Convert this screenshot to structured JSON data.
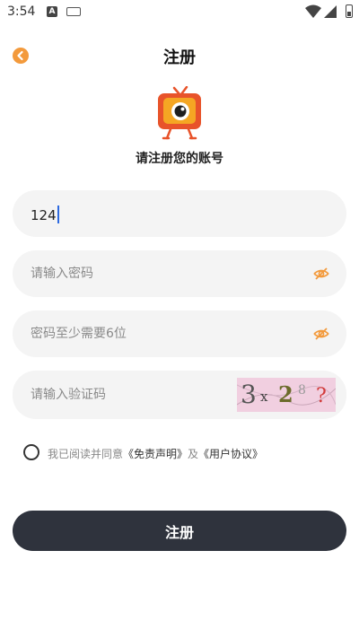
{
  "status_bar": {
    "time": "3:54",
    "notification_icon": "A",
    "icons": [
      "notification-a-icon",
      "keyboard-icon",
      "wifi-icon",
      "signal-icon",
      "battery-icon"
    ]
  },
  "header": {
    "title": "注册",
    "back_icon": "chevron-left-icon"
  },
  "logo": {
    "icon": "tv-mascot-logo"
  },
  "subtitle": "请注册您的账号",
  "form": {
    "username_value": "124",
    "password_placeholder": "请输入密码",
    "confirm_password_placeholder": "密码至少需要6位",
    "code_placeholder": "请输入验证码",
    "captcha_chars": [
      "3",
      "x",
      "2",
      "8",
      "?"
    ]
  },
  "agreement": {
    "prefix": "我已阅读并同意",
    "disclaimer_link": "《免责声明》",
    "joiner": "及",
    "terms_link": "《用户协议》"
  },
  "submit_label": "注册",
  "colors": {
    "accent": "#f39a3c",
    "logo_red": "#e8532a",
    "button_dark": "#2f333d",
    "field_bg": "#f4f4f4",
    "captcha_bg": "#f1cfe0"
  }
}
